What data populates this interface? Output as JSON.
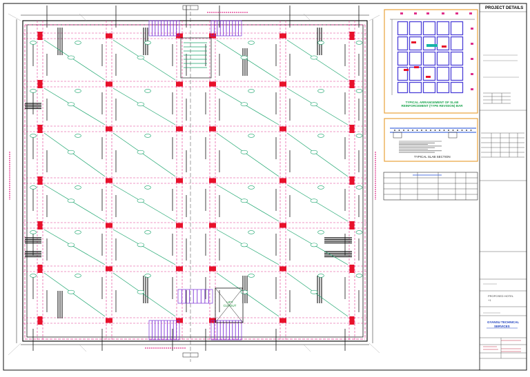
{
  "title_block": {
    "project_details_label": "PROJECT DETAILS",
    "drawing_title": "PROPOSED HOTEL",
    "drawing_subtitle": "+1",
    "company_line1": "GYANSU TECHNICAL",
    "company_line2": "SERVICES"
  },
  "key_plan": {
    "caption_line1": "TYPICAL ARRANGEMENT OF SLAB",
    "caption_line2": "REINFORCEMENT (TYPE REVISION) BAR"
  },
  "section_detail": {
    "caption": "TYPICAL SLAB SECTION"
  },
  "plan_labels": {
    "lift_line1": "LIFT",
    "lift_line2": "CUTOUT"
  },
  "colors": {
    "grid_magenta": "#e0308a",
    "column_red": "#e8102a",
    "rebar_green": "#16a36a",
    "stair_purple": "#7b2fd6",
    "frame_orange": "#e8a23a",
    "line_black": "#111111"
  }
}
